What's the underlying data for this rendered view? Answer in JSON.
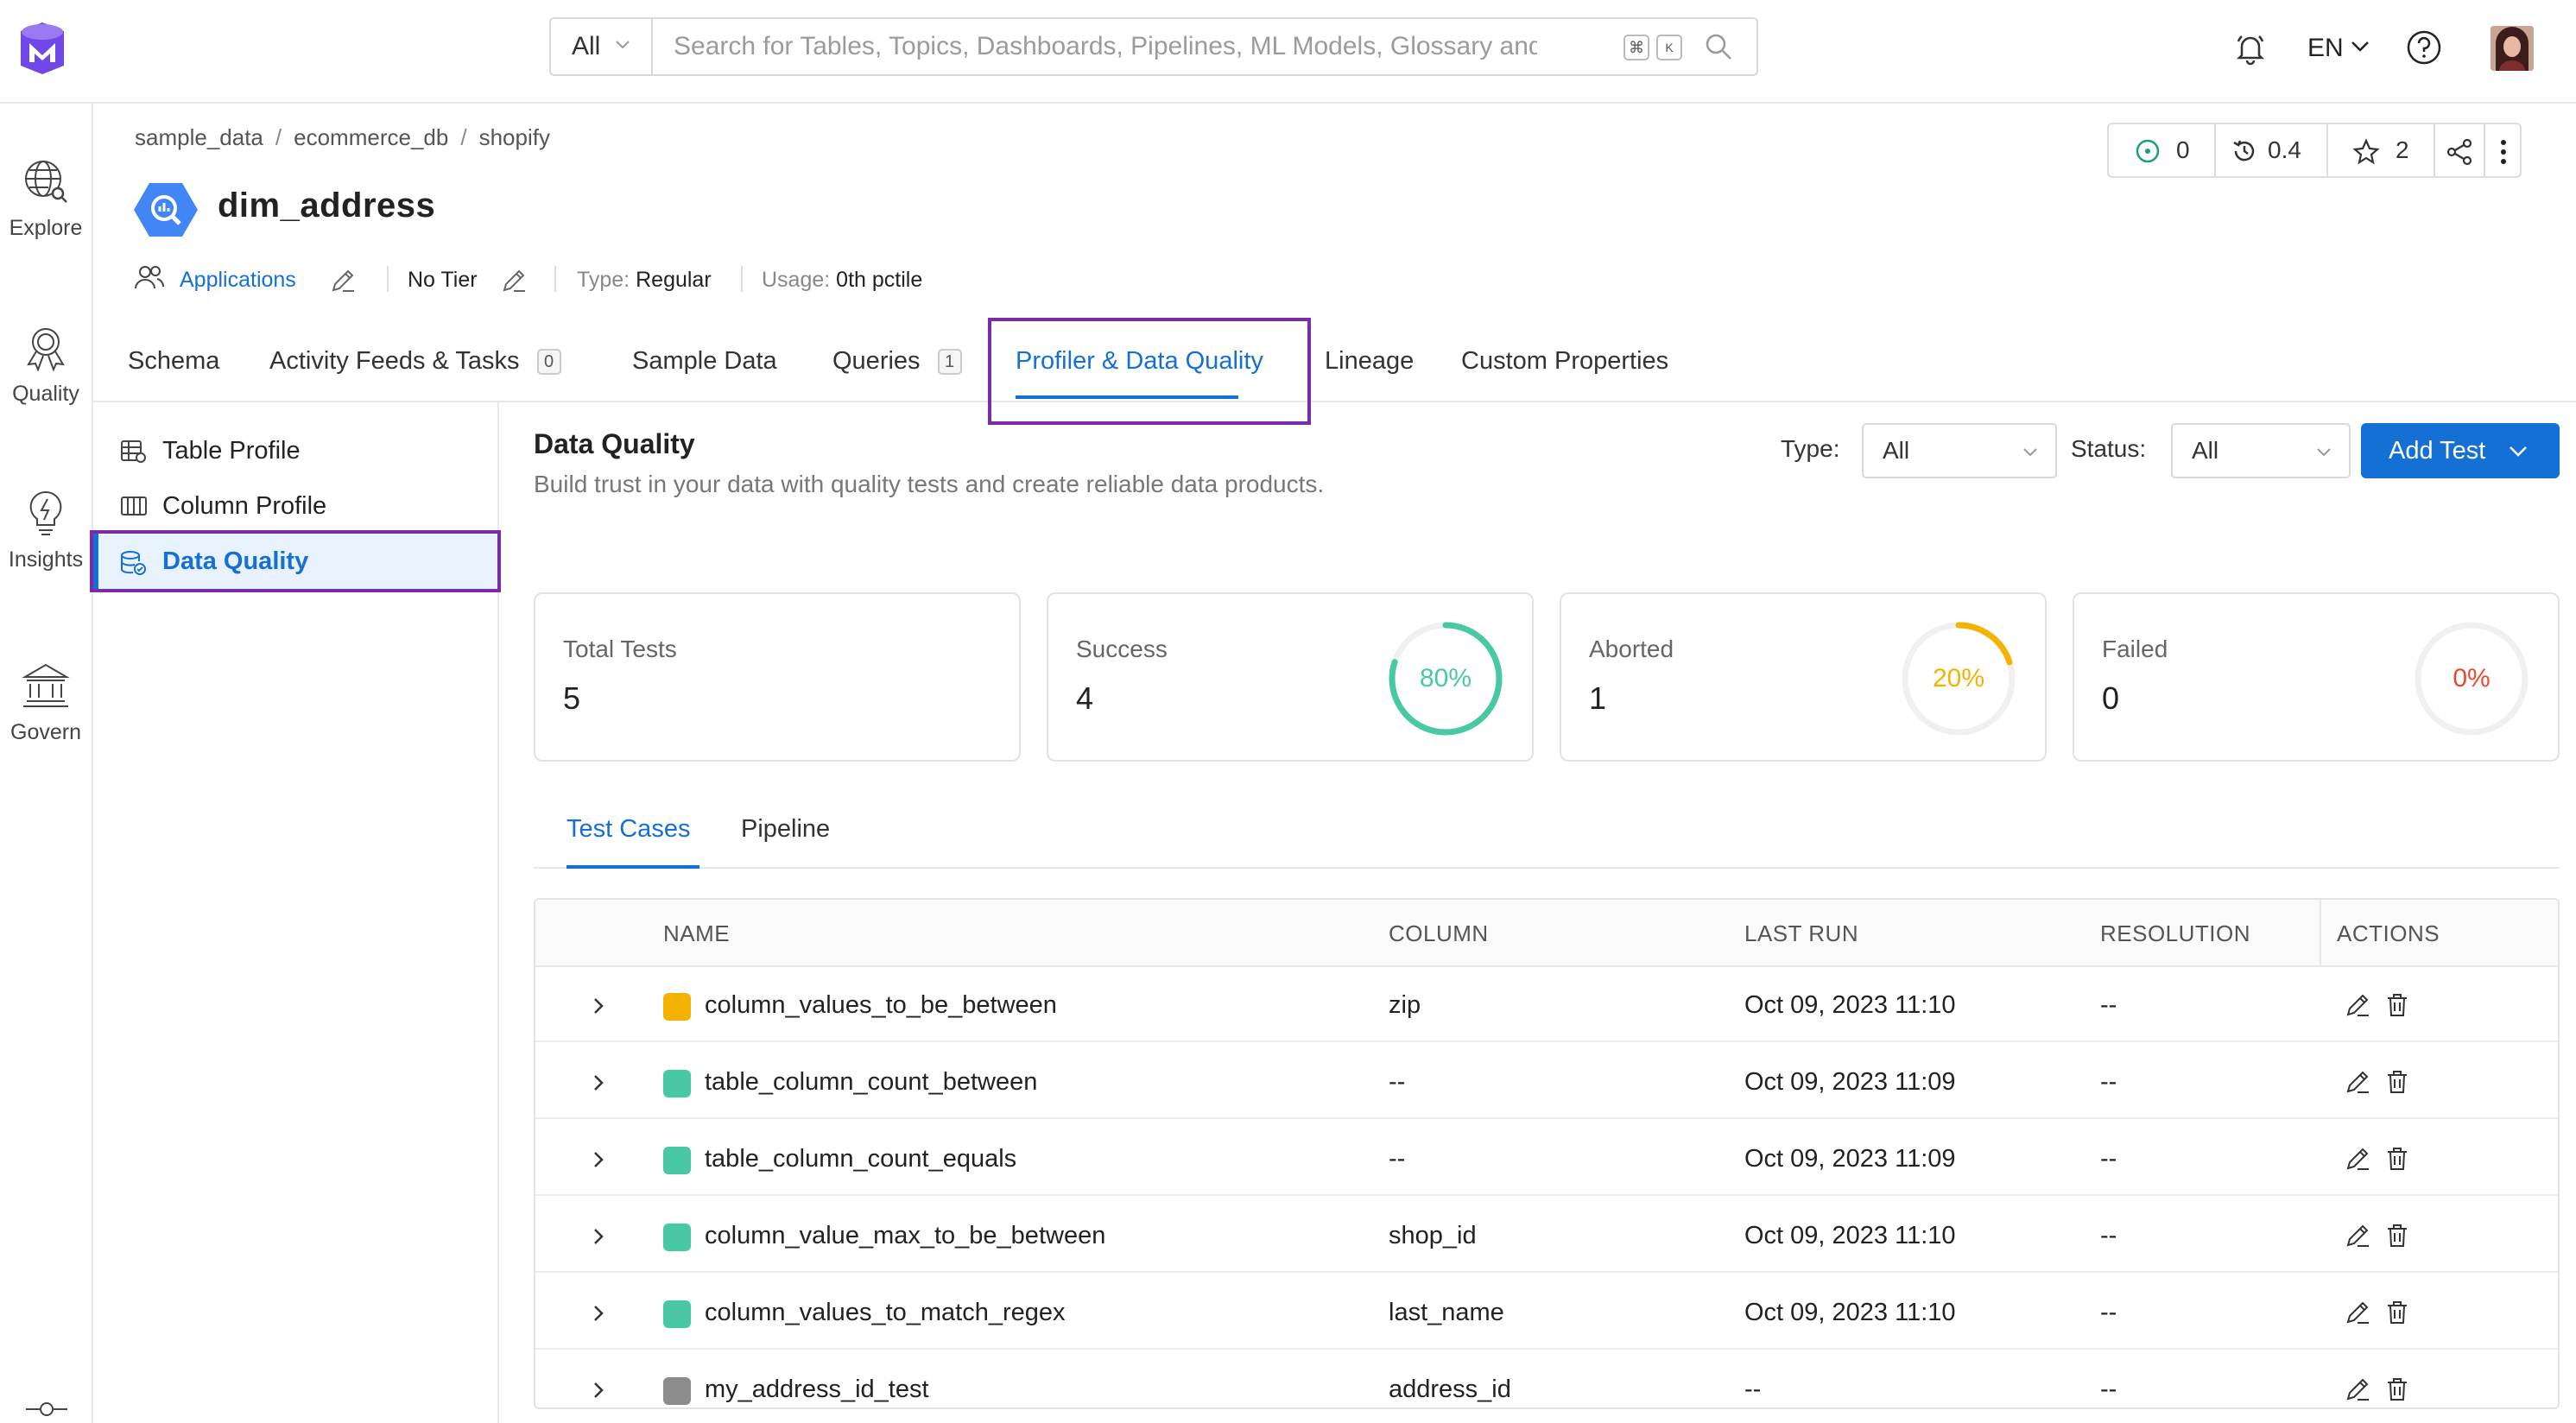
{
  "search": {
    "category": "All",
    "placeholder": "Search for Tables, Topics, Dashboards, Pipelines, ML Models, Glossary and Tag...",
    "shortcut_cmd": "⌘",
    "shortcut_key": "K"
  },
  "header": {
    "language": "EN"
  },
  "nav": {
    "items": [
      {
        "label": "Explore",
        "icon": "explore-icon"
      },
      {
        "label": "Quality",
        "icon": "quality-icon"
      },
      {
        "label": "Insights",
        "icon": "insights-icon"
      },
      {
        "label": "Govern",
        "icon": "govern-icon"
      }
    ]
  },
  "breadcrumb": [
    "sample_data",
    "ecommerce_db",
    "shopify"
  ],
  "entity": {
    "name": "dim_address",
    "owner": "Applications",
    "tier": "No Tier",
    "type_label": "Type:",
    "type_value": "Regular",
    "usage_label": "Usage:",
    "usage_value": "0th pctile"
  },
  "entity_actions": {
    "followers": "0",
    "version": "0.4",
    "stars": "2"
  },
  "tabs": [
    {
      "label": "Schema"
    },
    {
      "label": "Activity Feeds & Tasks",
      "count": "0"
    },
    {
      "label": "Sample Data"
    },
    {
      "label": "Queries",
      "count": "1"
    },
    {
      "label": "Profiler & Data Quality",
      "active": true
    },
    {
      "label": "Lineage"
    },
    {
      "label": "Custom Properties"
    }
  ],
  "subnav": [
    {
      "label": "Table Profile"
    },
    {
      "label": "Column Profile"
    },
    {
      "label": "Data Quality",
      "active": true
    }
  ],
  "data_quality": {
    "title": "Data Quality",
    "description": "Build trust in your data with quality tests and create reliable data products.",
    "type_label": "Type",
    "type_value": "All",
    "status_label": "Status",
    "status_value": "All",
    "add_test": "Add Test"
  },
  "summary": {
    "total": {
      "label": "Total Tests",
      "value": "5"
    },
    "success": {
      "label": "Success",
      "value": "4",
      "percent": "80%",
      "fraction": 0.8,
      "color": "#48c9a3"
    },
    "aborted": {
      "label": "Aborted",
      "value": "1",
      "percent": "20%",
      "fraction": 0.2,
      "color": "#f5b301"
    },
    "failed": {
      "label": "Failed",
      "value": "0",
      "percent": "0%",
      "fraction": 0,
      "color": "#e84a2f"
    }
  },
  "subtabs": [
    "Test Cases",
    "Pipeline"
  ],
  "table": {
    "headers": [
      "NAME",
      "COLUMN",
      "LAST RUN",
      "RESOLUTION",
      "ACTIONS"
    ],
    "rows": [
      {
        "status": "aborted",
        "name": "column_values_to_be_between",
        "column": "zip",
        "last_run": "Oct 09, 2023 11:10",
        "resolution": "--"
      },
      {
        "status": "success",
        "name": "table_column_count_between",
        "column": "--",
        "last_run": "Oct 09, 2023 11:09",
        "resolution": "--"
      },
      {
        "status": "success",
        "name": "table_column_count_equals",
        "column": "--",
        "last_run": "Oct 09, 2023 11:09",
        "resolution": "--"
      },
      {
        "status": "success",
        "name": "column_value_max_to_be_between",
        "column": "shop_id",
        "last_run": "Oct 09, 2023 11:10",
        "resolution": "--"
      },
      {
        "status": "success",
        "name": "column_values_to_match_regex",
        "column": "last_name",
        "last_run": "Oct 09, 2023 11:10",
        "resolution": "--"
      },
      {
        "status": "queued",
        "name": "my_address_id_test",
        "column": "address_id",
        "last_run": "--",
        "resolution": "--"
      }
    ]
  },
  "colors": {
    "accent": "#1570d5",
    "success": "#48c9a3",
    "aborted": "#f5b301",
    "queued": "#8c8c8c",
    "highlight": "#7a2ba8"
  }
}
